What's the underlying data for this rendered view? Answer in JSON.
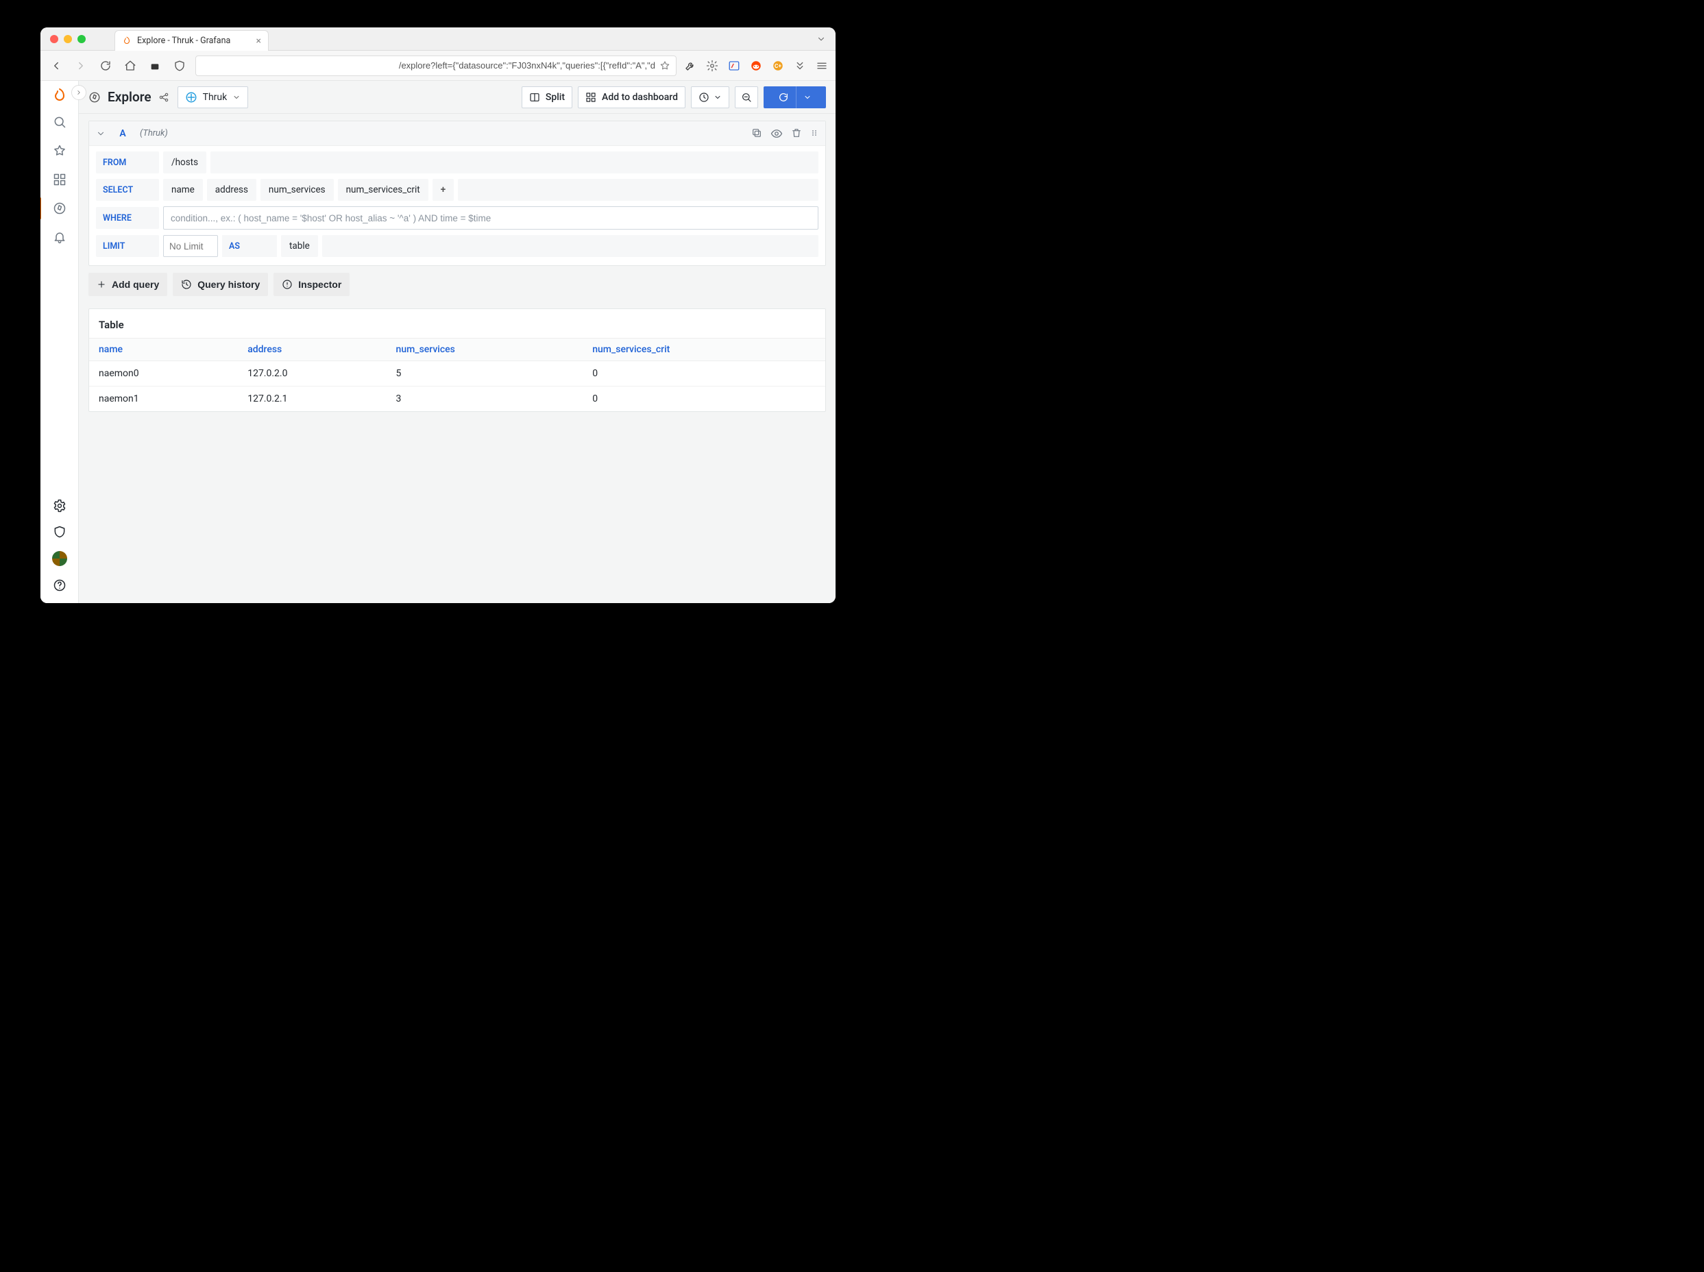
{
  "tab": {
    "title": "Explore - Thruk - Grafana"
  },
  "urlbar": {
    "url": "/explore?left={\"datasource\":\"FJ03nxN4k\",\"queries\":[{\"refId\":\"A\",\"d"
  },
  "page": {
    "title": "Explore",
    "datasource": "Thruk",
    "split": "Split",
    "addDashboard": "Add to dashboard"
  },
  "query": {
    "refId": "A",
    "dsHint": "(Thruk)",
    "kw": {
      "from": "FROM",
      "select": "SELECT",
      "where": "WHERE",
      "limit": "LIMIT",
      "as": "AS"
    },
    "from": "/hosts",
    "selects": [
      "name",
      "address",
      "num_services",
      "num_services_crit"
    ],
    "addField": "+",
    "wherePlaceholder": "condition..., ex.: ( host_name = '$host' OR host_alias ~ '^a' ) AND time = $time",
    "limitPlaceholder": "No Limit",
    "as": "table"
  },
  "actions": {
    "addQuery": "Add query",
    "history": "Query history",
    "inspector": "Inspector"
  },
  "table": {
    "title": "Table",
    "columns": [
      "name",
      "address",
      "num_services",
      "num_services_crit"
    ],
    "rows": [
      {
        "name": "naemon0",
        "address": "127.0.2.0",
        "num_services": "5",
        "num_services_crit": "0"
      },
      {
        "name": "naemon1",
        "address": "127.0.2.1",
        "num_services": "3",
        "num_services_crit": "0"
      }
    ]
  }
}
